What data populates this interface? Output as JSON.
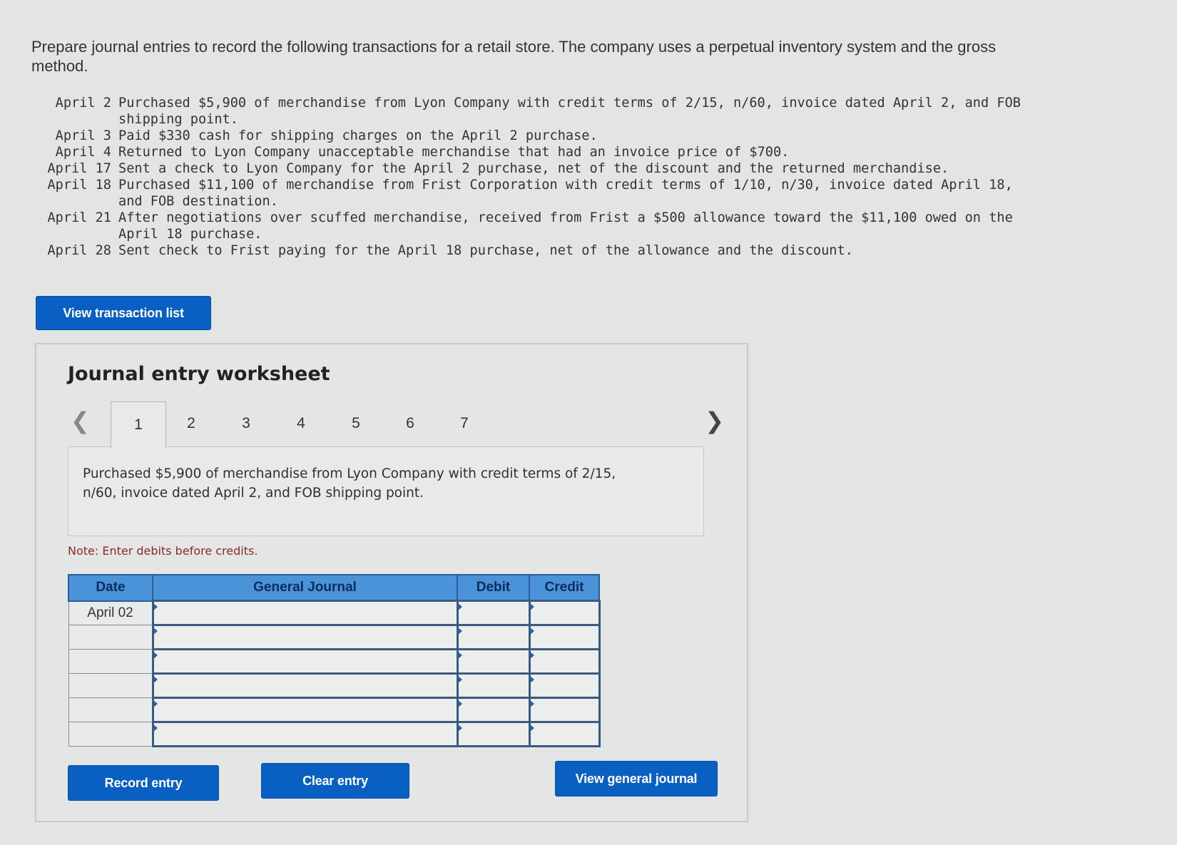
{
  "intro": "Prepare journal entries to record the following transactions for a retail store. The company uses a perpetual inventory system and the gross method.",
  "transactions": [
    {
      "date": " April 2",
      "text": "Purchased $5,900 of merchandise from Lyon Company with credit terms of 2/15, n/60, invoice dated April 2, and FOB shipping point."
    },
    {
      "date": " April 3",
      "text": "Paid $330 cash for shipping charges on the April 2 purchase."
    },
    {
      "date": " April 4",
      "text": "Returned to Lyon Company unacceptable merchandise that had an invoice price of $700."
    },
    {
      "date": "April 17",
      "text": "Sent a check to Lyon Company for the April 2 purchase, net of the discount and the returned merchandise."
    },
    {
      "date": "April 18",
      "text": "Purchased $11,100 of merchandise from Frist Corporation with credit terms of 1/10, n/30, invoice dated April 18, and FOB destination."
    },
    {
      "date": "April 21",
      "text": "After negotiations over scuffed merchandise, received from Frist a $500 allowance toward the $11,100 owed on the April 18 purchase."
    },
    {
      "date": "April 28",
      "text": "Sent check to Frist paying for the April 18 purchase, net of the allowance and the discount."
    }
  ],
  "buttons": {
    "view_transaction_list": "View transaction list",
    "record_entry": "Record entry",
    "clear_entry": "Clear entry",
    "view_general_journal": "View general journal"
  },
  "worksheet": {
    "title": "Journal entry worksheet",
    "tabs": [
      "1",
      "2",
      "3",
      "4",
      "5",
      "6",
      "7"
    ],
    "active_tab": "1",
    "description": "Purchased $5,900 of merchandise from Lyon Company with credit terms of 2/15, n/60, invoice dated April 2, and FOB shipping point.",
    "note": "Note: Enter debits before credits.",
    "table": {
      "headers": [
        "Date",
        "General Journal",
        "Debit",
        "Credit"
      ],
      "rows": [
        {
          "date": "April 02",
          "account": "",
          "debit": "",
          "credit": ""
        },
        {
          "date": "",
          "account": "",
          "debit": "",
          "credit": ""
        },
        {
          "date": "",
          "account": "",
          "debit": "",
          "credit": ""
        },
        {
          "date": "",
          "account": "",
          "debit": "",
          "credit": ""
        },
        {
          "date": "",
          "account": "",
          "debit": "",
          "credit": ""
        },
        {
          "date": "",
          "account": "",
          "debit": "",
          "credit": ""
        }
      ]
    }
  },
  "colors": {
    "button_blue": "#0a5fc2",
    "header_blue": "#4a93d8",
    "note_red": "#8a2a2a"
  }
}
